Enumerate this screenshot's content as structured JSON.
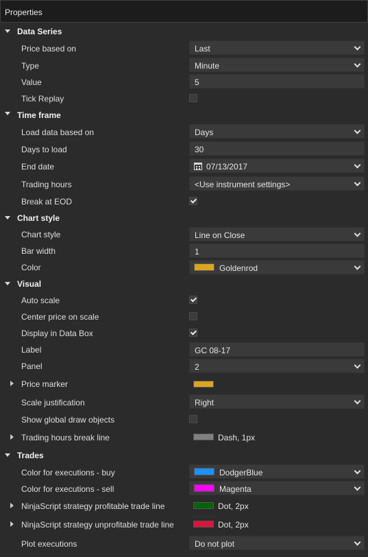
{
  "window": {
    "title": "Properties"
  },
  "sections": {
    "data_series": {
      "title": "Data Series",
      "price_based_on": {
        "label": "Price based on",
        "value": "Last"
      },
      "type": {
        "label": "Type",
        "value": "Minute"
      },
      "value": {
        "label": "Value",
        "value": "5"
      },
      "tick_replay": {
        "label": "Tick Replay",
        "checked": false
      }
    },
    "time_frame": {
      "title": "Time frame",
      "load_data_based_on": {
        "label": "Load data based on",
        "value": "Days"
      },
      "days_to_load": {
        "label": "Days to load",
        "value": "30"
      },
      "end_date": {
        "label": "End date",
        "value": "07/13/2017"
      },
      "trading_hours": {
        "label": "Trading hours",
        "value": "<Use instrument settings>"
      },
      "break_at_eod": {
        "label": "Break at EOD",
        "checked": true
      }
    },
    "chart_style": {
      "title": "Chart style",
      "chart_style": {
        "label": "Chart style",
        "value": "Line on Close"
      },
      "bar_width": {
        "label": "Bar width",
        "value": "1"
      },
      "color": {
        "label": "Color",
        "value": "Goldenrod",
        "swatch": "#daa520"
      }
    },
    "visual": {
      "title": "Visual",
      "auto_scale": {
        "label": "Auto scale",
        "checked": true
      },
      "center_price_on_scale": {
        "label": "Center price on scale",
        "checked": false
      },
      "display_in_data_box": {
        "label": "Display in Data Box",
        "checked": true
      },
      "label": {
        "label": "Label",
        "value": "GC 08-17"
      },
      "panel": {
        "label": "Panel",
        "value": "2"
      },
      "price_marker": {
        "label": "Price marker",
        "swatch": "#daa520"
      },
      "scale_justification": {
        "label": "Scale justification",
        "value": "Right"
      },
      "show_global_draw_objects": {
        "label": "Show global draw objects",
        "checked": false
      },
      "trading_hours_break_line": {
        "label": "Trading hours break line",
        "value": "Dash, 1px",
        "swatch": "#808080"
      }
    },
    "trades": {
      "title": "Trades",
      "color_buy": {
        "label": "Color for executions - buy",
        "value": "DodgerBlue",
        "swatch": "#1e90ff"
      },
      "color_sell": {
        "label": "Color for executions - sell",
        "value": "Magenta",
        "swatch": "#ff00ff"
      },
      "profitable_line": {
        "label": "NinjaScript strategy profitable trade line",
        "value": "Dot, 2px",
        "swatch": "#006400"
      },
      "unprofitable_line": {
        "label": "NinjaScript strategy unprofitable trade line",
        "value": "Dot, 2px",
        "swatch": "#dc143c"
      },
      "plot_executions": {
        "label": "Plot executions",
        "value": "Do not plot"
      }
    }
  }
}
